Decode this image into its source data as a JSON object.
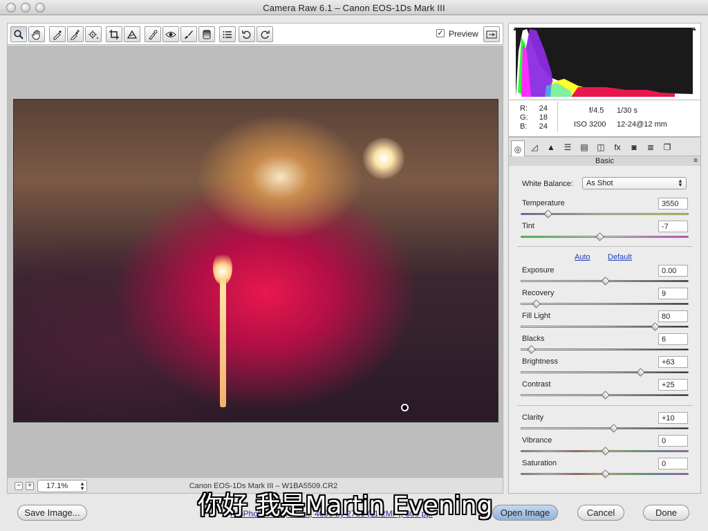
{
  "window": {
    "title": "Camera Raw 6.1  –  Canon EOS-1Ds Mark III"
  },
  "toolbar": {
    "tools": [
      {
        "name": "zoom-tool",
        "icon": "magnifier-icon"
      },
      {
        "name": "hand-tool",
        "icon": "hand-icon"
      },
      {
        "name": "white-balance-tool",
        "icon": "eyedropper-icon"
      },
      {
        "name": "color-sampler-tool",
        "icon": "eyedropper-plus-icon"
      },
      {
        "name": "targeted-adjustment-tool",
        "icon": "target-adjust-icon"
      },
      {
        "name": "crop-tool",
        "icon": "crop-icon"
      },
      {
        "name": "straighten-tool",
        "icon": "straighten-icon"
      },
      {
        "name": "spot-removal-tool",
        "icon": "spot-removal-icon"
      },
      {
        "name": "red-eye-tool",
        "icon": "red-eye-icon"
      },
      {
        "name": "adjustment-brush-tool",
        "icon": "brush-icon"
      },
      {
        "name": "graduated-filter-tool",
        "icon": "graduated-filter-icon"
      },
      {
        "name": "preferences-tool",
        "icon": "list-icon"
      },
      {
        "name": "rotate-left-tool",
        "icon": "rotate-ccw-icon"
      },
      {
        "name": "rotate-right-tool",
        "icon": "rotate-cw-icon"
      }
    ],
    "preview_label": "Preview",
    "preview_checked": true
  },
  "statusbar": {
    "zoom": "17.1%",
    "file_name": "Canon EOS-1Ds Mark III  –  W1BA5509.CR2"
  },
  "readout": {
    "r_label": "R:",
    "r": "24",
    "g_label": "G:",
    "g": "18",
    "b_label": "B:",
    "b": "24",
    "aperture": "f/4.5",
    "shutter": "1/30 s",
    "iso": "ISO 3200",
    "lens": "12-24@12 mm"
  },
  "panel": {
    "tabs": [
      "basic-icon",
      "tone-curve-icon",
      "detail-icon",
      "hsl-icon",
      "split-toning-icon",
      "lens-corrections-icon",
      "effects-icon",
      "camera-calibration-icon",
      "presets-icon",
      "snapshots-icon"
    ],
    "header": "Basic",
    "white_balance_label": "White Balance:",
    "white_balance_value": "As Shot",
    "auto_label": "Auto",
    "default_label": "Default",
    "sliders": [
      {
        "label": "Temperature",
        "value": "3550",
        "position": 0.16
      },
      {
        "label": "Tint",
        "value": "-7",
        "position": 0.47
      },
      {
        "label": "Exposure",
        "value": "0.00",
        "position": 0.5
      },
      {
        "label": "Recovery",
        "value": "9",
        "position": 0.09
      },
      {
        "label": "Fill Light",
        "value": "80",
        "position": 0.8
      },
      {
        "label": "Blacks",
        "value": "6",
        "position": 0.06
      },
      {
        "label": "Brightness",
        "value": "+63",
        "position": 0.71
      },
      {
        "label": "Contrast",
        "value": "+25",
        "position": 0.5
      },
      {
        "label": "Clarity",
        "value": "+10",
        "position": 0.55
      },
      {
        "label": "Vibrance",
        "value": "0",
        "position": 0.5
      },
      {
        "label": "Saturation",
        "value": "0",
        "position": 0.5
      }
    ]
  },
  "footer": {
    "save_label": "Save Image...",
    "workflow": "ProPhoto RGB; 16 bit; 4096 by 2731 (11.2MP); 300 ppi",
    "open_label": "Open Image",
    "cancel_label": "Cancel",
    "done_label": "Done"
  },
  "subtitle": "你好 我是Martin Evening",
  "colors": {
    "accent": "#1b3fb5",
    "skin": "#e8184e"
  }
}
